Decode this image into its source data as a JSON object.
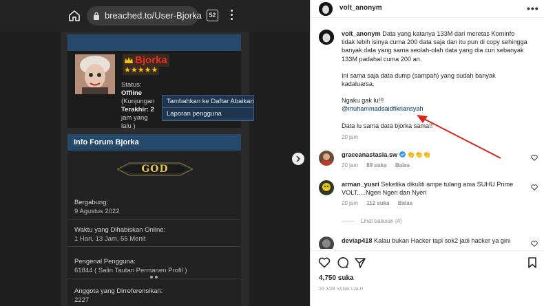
{
  "browser": {
    "url": "breached.to/User-Bjorka",
    "tab_count": "52"
  },
  "profile": {
    "username": "Bjorka",
    "stars": "★★★★★",
    "status_label": "Status:",
    "status_value": "Offline",
    "visit_line": "(Kunjungan",
    "last_label": "Terakhir: 2",
    "last_line2": "jam yang",
    "last_line3": "lalu )"
  },
  "context_menu": {
    "items": [
      "Tambahkan ke Daftar Abaikan",
      "Laporan pengguna"
    ]
  },
  "forum_info": {
    "title": "Info Forum Bjorka",
    "badge": "GOD",
    "rows": [
      {
        "label": "Bergabung:",
        "value": "9 Agustus 2022"
      },
      {
        "label": "Waktu yang Dihabiskan Online:",
        "value": "1 Hari, 13 Jam, 55 Menit"
      },
      {
        "label": "Pengenal Pengguna:",
        "value": "61844 ( Salin Tautan Permanen Profil )"
      },
      {
        "label": "Anggota yang Dirreferensikan:",
        "value": "2227"
      }
    ]
  },
  "instagram": {
    "account": "volt_anonym",
    "caption": {
      "username": "volt_anonym",
      "p1": "Data yang katanya 133M dari meretas Kominfo tidak lebih isinya cuma 200 data saja dan itu pun di copy sehingga banyak data yang sama seolah-olah data yang dia curi sebanyak 133M padahal cuma 200 an.",
      "p2": "Ini sama saja data dump (sampah) yang sudah banyak kadaluarsa.",
      "p3a": "Ngaku gak lu!!!",
      "mention": "@muhammadsaidfikriansyah",
      "p4": "Data lu sama data bjorka sama!!",
      "time": "20 jam"
    },
    "comments": [
      {
        "username": "graceanastasia.sw",
        "text": "👏👏👏",
        "time": "20 jam",
        "likes": "89 suka",
        "reply": "Balas"
      },
      {
        "username": "arman_yusri",
        "text": "Seketika dikuliti ampe tulang ama SUHU Prime VOLT.....Ngeri Ngeri dan Nyeri",
        "time": "20 jam",
        "likes": "112 suka",
        "reply": "Balas"
      },
      {
        "username": "deviap418",
        "text": "Kalau bukan Hacker tapi sok2 jadi hacker ya gini",
        "time": "",
        "likes": "",
        "reply": ""
      }
    ],
    "view_replies": "Lihat balasan (4)",
    "likes_count": "4,750 suka",
    "posted": "20 JAM YANG LALU"
  },
  "colors": {
    "accent_blue": "#24496b",
    "username_red": "#e7301f",
    "star_gold": "#f2c511",
    "arrow_red": "#d9241e",
    "mention_blue": "#00376b"
  }
}
